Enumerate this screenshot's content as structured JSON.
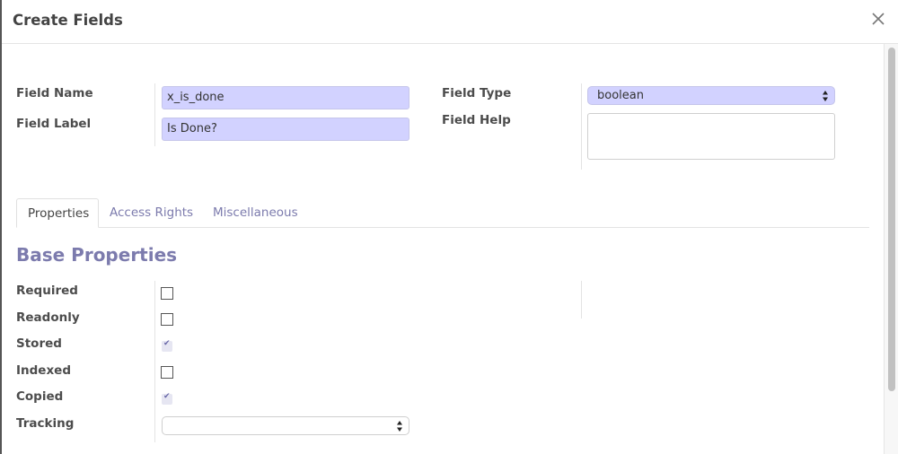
{
  "dialog": {
    "title": "Create Fields",
    "close_icon": "close-icon"
  },
  "form": {
    "field_name": {
      "label": "Field Name",
      "value": "x_is_done"
    },
    "field_label": {
      "label": "Field Label",
      "value": "Is Done?"
    },
    "field_type": {
      "label": "Field Type",
      "value": "boolean"
    },
    "field_help": {
      "label": "Field Help",
      "value": ""
    }
  },
  "tabs": [
    {
      "label": "Properties",
      "active": true
    },
    {
      "label": "Access Rights",
      "active": false
    },
    {
      "label": "Miscellaneous",
      "active": false
    }
  ],
  "section": {
    "title": "Base Properties",
    "properties": [
      {
        "label": "Required",
        "checked": false,
        "disabled": false
      },
      {
        "label": "Readonly",
        "checked": false,
        "disabled": false
      },
      {
        "label": "Stored",
        "checked": true,
        "disabled": true
      },
      {
        "label": "Indexed",
        "checked": false,
        "disabled": false
      },
      {
        "label": "Copied",
        "checked": true,
        "disabled": true
      }
    ],
    "tracking": {
      "label": "Tracking",
      "value": ""
    }
  },
  "colors": {
    "accent": "#7c7bad",
    "input_highlight": "#d2d2ff"
  }
}
